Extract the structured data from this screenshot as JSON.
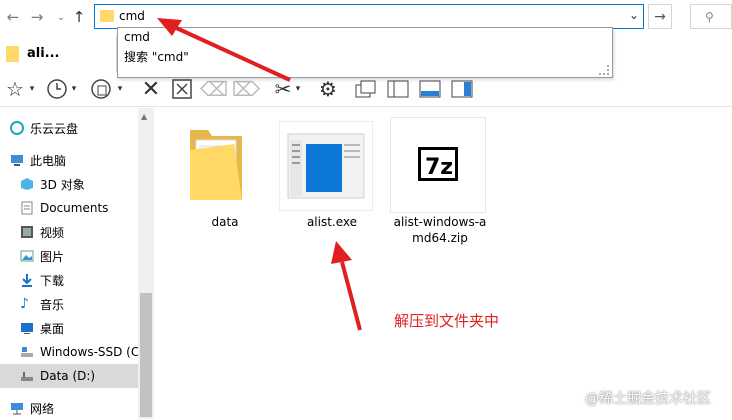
{
  "address": {
    "value": "cmd"
  },
  "dropdown": {
    "items": [
      "cmd",
      "搜索 \"cmd\""
    ]
  },
  "tab": {
    "label": "ali..."
  },
  "sidebar": {
    "items": [
      {
        "label": "乐云云盘",
        "icon": "cloud-icon"
      },
      {
        "label": "此电脑",
        "icon": "computer-icon"
      },
      {
        "label": "3D 对象",
        "icon": "3d-objects-icon"
      },
      {
        "label": "Documents",
        "icon": "documents-icon"
      },
      {
        "label": "视频",
        "icon": "video-icon"
      },
      {
        "label": "图片",
        "icon": "pictures-icon"
      },
      {
        "label": "下载",
        "icon": "download-icon"
      },
      {
        "label": "音乐",
        "icon": "music-icon"
      },
      {
        "label": "桌面",
        "icon": "desktop-icon"
      },
      {
        "label": "Windows-SSD (C",
        "icon": "drive-icon"
      },
      {
        "label": "Data (D:)",
        "icon": "drive-icon"
      },
      {
        "label": "网络",
        "icon": "network-icon"
      }
    ]
  },
  "files": [
    {
      "name": "data",
      "type": "folder"
    },
    {
      "name": "alist.exe",
      "type": "exe"
    },
    {
      "name_line1": "alist-windows-a",
      "name_line2": "md64.zip",
      "type": "7z-archive"
    }
  ],
  "annotation": "解压到文件夹中",
  "watermark": "@稀土掘金技术社区",
  "colors": {
    "accent": "#0078d7",
    "annotation": "#e02020",
    "folder": "#ffd866",
    "selected": "#d9d9d9"
  }
}
